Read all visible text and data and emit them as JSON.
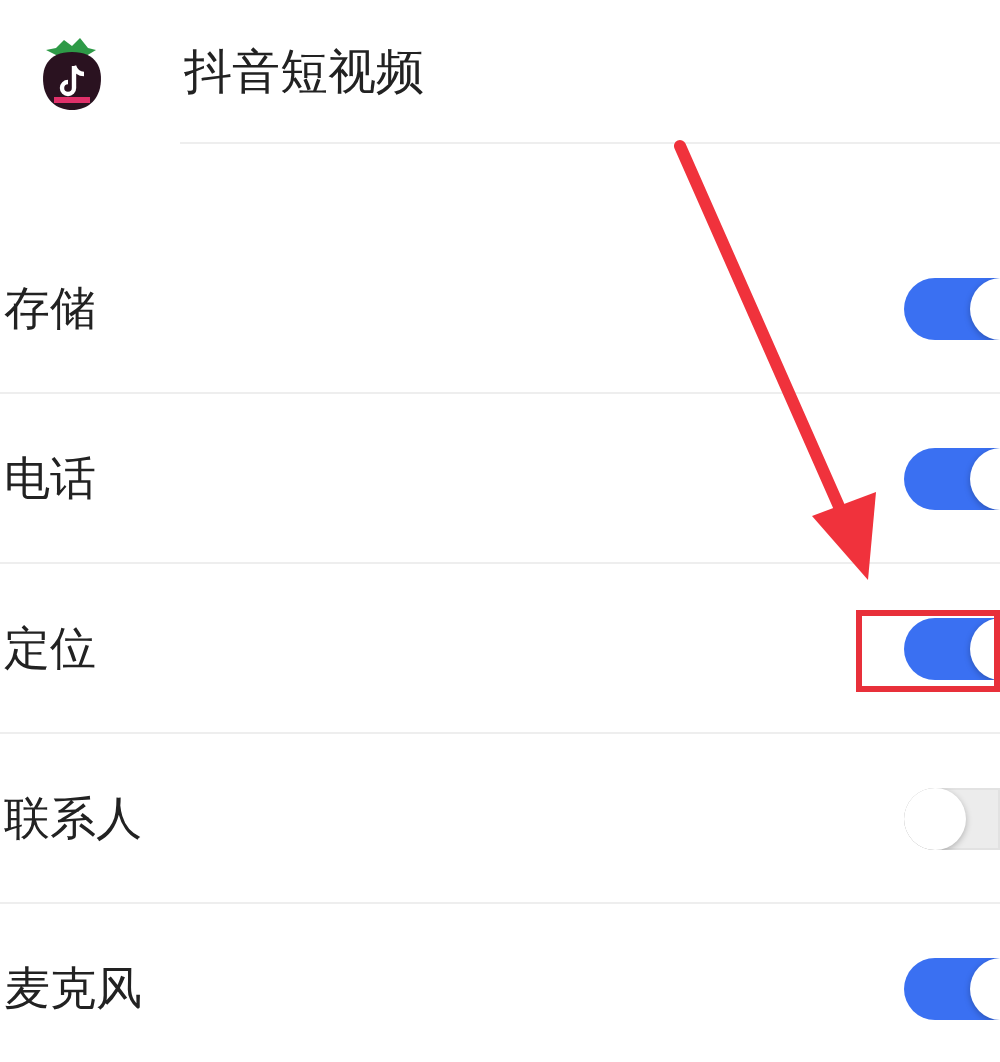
{
  "app": {
    "name": "抖音短视频"
  },
  "permissions": [
    {
      "label": "存储",
      "on": true,
      "highlighted": false
    },
    {
      "label": "电话",
      "on": true,
      "highlighted": false
    },
    {
      "label": "定位",
      "on": true,
      "highlighted": true
    },
    {
      "label": "联系人",
      "on": false,
      "highlighted": false
    },
    {
      "label": "麦克风",
      "on": true,
      "highlighted": false
    }
  ]
}
